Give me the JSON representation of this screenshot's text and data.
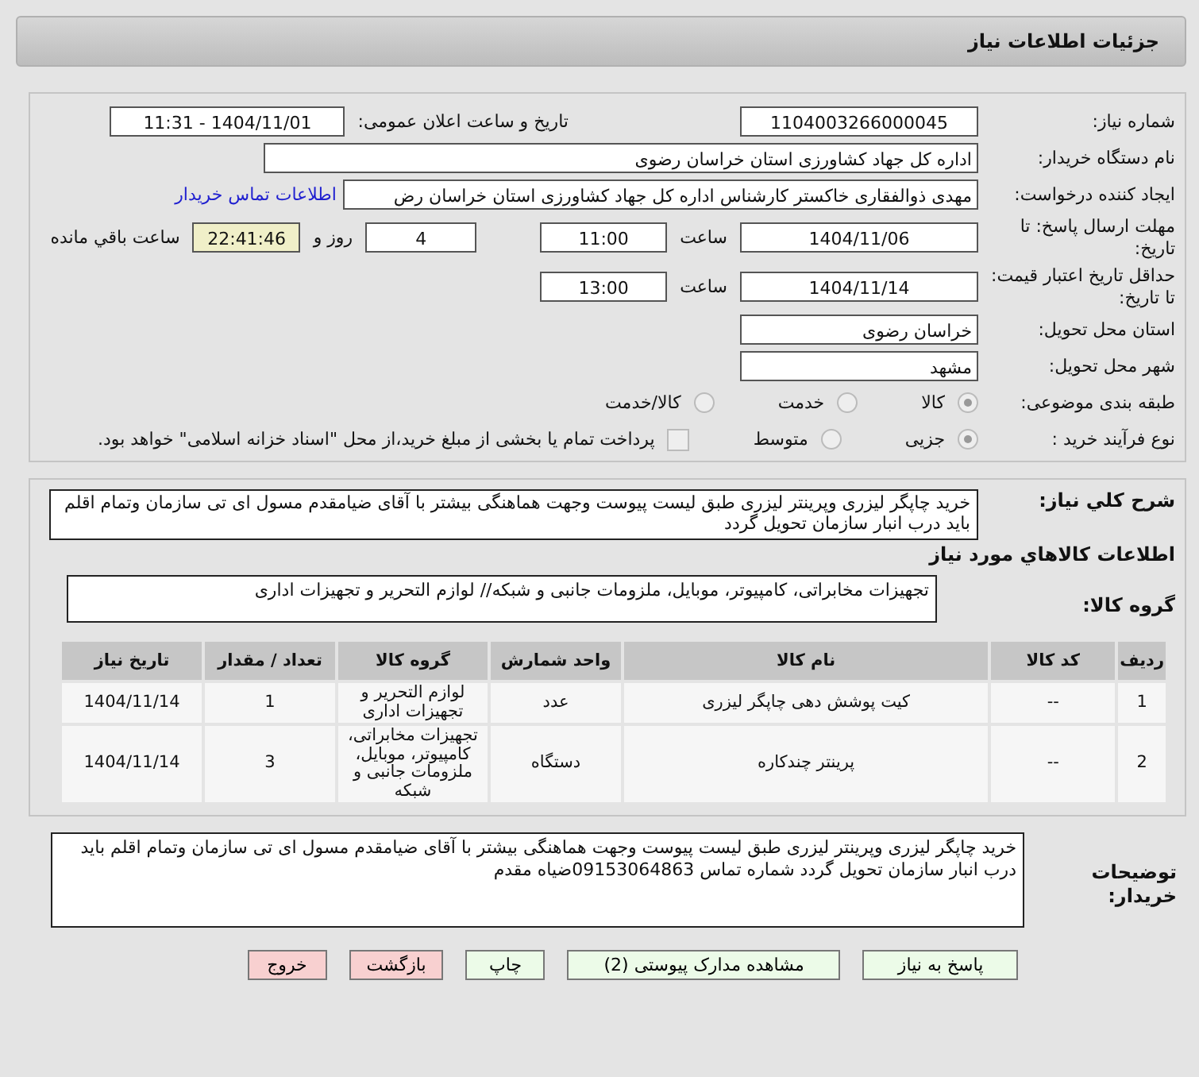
{
  "title": "جزئیات اطلاعات نیاز",
  "need_number": {
    "label": "شماره نیاز:",
    "value": "1104003266000045"
  },
  "announce": {
    "label": "تاریخ و ساعت اعلان عمومی:",
    "value": "1404/11/01 - 11:31"
  },
  "buyer": {
    "label": "نام دستگاه خریدار:",
    "value": "اداره کل جهاد کشاورزی استان خراسان رضوی"
  },
  "creator": {
    "label": "ایجاد کننده درخواست:",
    "value": "مهدی ذوالفقاری خاکستر کارشناس  اداره کل جهاد کشاورزی استان خراسان رض",
    "link": "اطلاعات تماس خریدار"
  },
  "deadline": {
    "label": "مهلت ارسال پاسخ: تا تاریخ:",
    "date": "1404/11/06",
    "time_label": "ساعت",
    "time": "11:00",
    "days": "4",
    "days_label": "روز و",
    "remaining": "22:41:46",
    "remaining_label": "ساعت باقي مانده"
  },
  "validity": {
    "label": "حداقل تاریخ اعتبار قیمت: تا تاریخ:",
    "date": "1404/11/14",
    "time_label": "ساعت",
    "time": "13:00"
  },
  "province": {
    "label": "استان محل تحویل:",
    "value": "خراسان رضوی"
  },
  "city": {
    "label": "شهر محل تحویل:",
    "value": "مشهد"
  },
  "category": {
    "label": "طبقه بندی موضوعی:",
    "options": [
      {
        "label": "کالا",
        "selected": true
      },
      {
        "label": "خدمت",
        "selected": false
      },
      {
        "label": "کالا/خدمت",
        "selected": false
      }
    ]
  },
  "process": {
    "label": "نوع فرآیند خرید :",
    "options": [
      {
        "label": "جزیی",
        "selected": true
      },
      {
        "label": "متوسط",
        "selected": false
      }
    ],
    "payment": {
      "label": "پرداخت تمام یا بخشی از مبلغ خرید،از محل \"اسناد خزانه اسلامی\" خواهد بود.",
      "checked": false
    }
  },
  "description": {
    "label": "شرح کلي نياز:",
    "value": "خرید چاپگر لیزری وپرینتر لیزری طبق لیست پیوست وجهت هماهنگی بیشتر با آقای ضیامقدم مسول ای تی سازمان وتمام اقلم باید درب انبار سازمان تحویل گردد"
  },
  "goods_heading": "اطلاعات کالاهاي مورد نياز",
  "goods_group": {
    "label": "گروه کالا:",
    "value": "تجهیزات مخابراتی، کامپیوتر، موبایل، ملزومات جانبی و شبکه// لوازم التحریر و تجهیزات اداری"
  },
  "table": {
    "columns": [
      "ردیف",
      "کد کالا",
      "نام کالا",
      "واحد شمارش",
      "گروه کالا",
      "تعداد / مقدار",
      "تاریخ نیاز"
    ],
    "rows": [
      [
        "1",
        "--",
        "کیت پوشش دهی چاپگر لیزری",
        "عدد",
        "لوازم التحریر و تجهیزات اداری",
        "1",
        "1404/11/14"
      ],
      [
        "2",
        "--",
        "پرینتر چندکاره",
        "دستگاه",
        "تجهیزات مخابراتی، کامپیوتر، موبایل، ملزومات جانبی و شبکه",
        "3",
        "1404/11/14"
      ]
    ]
  },
  "buyer_notes": {
    "label": "توضیحات خریدار:",
    "value": "خرید چاپگر لیزری وپرینتر لیزری طبق لیست پیوست وجهت هماهنگی بیشتر با آقای ضیامقدم مسول ای تی سازمان وتمام اقلم باید درب انبار سازمان تحویل گردد شماره تماس 09153064863ضیاه مقدم"
  },
  "buttons": [
    {
      "label": "پاسخ به نیاز",
      "kind": "normal"
    },
    {
      "label": "مشاهده مدارک پیوستی (2)",
      "kind": "normal"
    },
    {
      "label": "چاپ",
      "kind": "normal"
    },
    {
      "label": "بازگشت",
      "kind": "danger"
    },
    {
      "label": "خروج",
      "kind": "danger"
    }
  ]
}
